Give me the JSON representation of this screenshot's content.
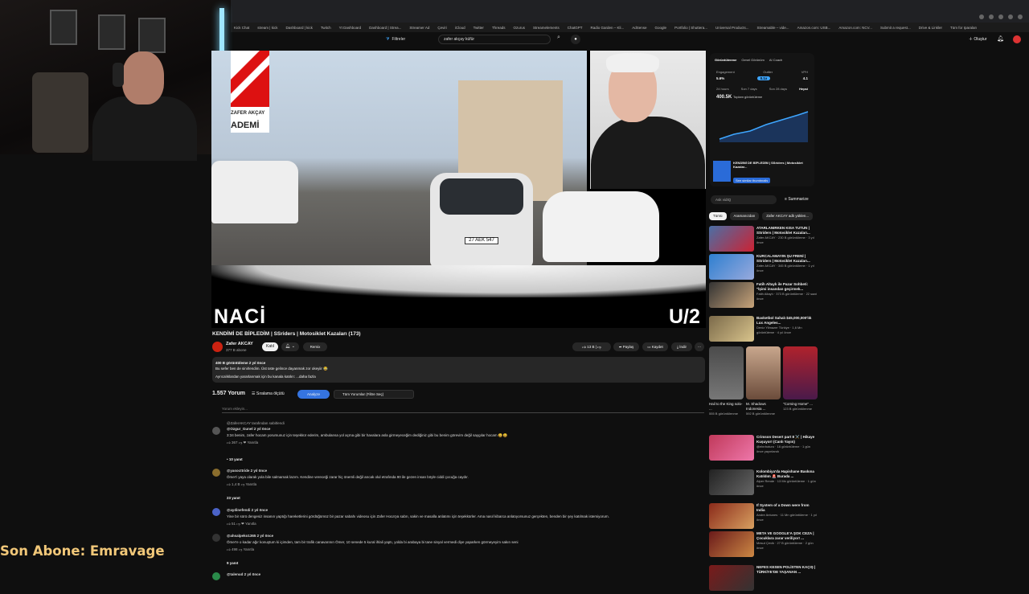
{
  "browser": {
    "bookmarks": [
      "Kick Chat",
      "stream | kick",
      "Dashboard | kick",
      "Twitch",
      "Yt Dashboard",
      "Dashboard | Strea...",
      "Streamer Ad",
      "Çeviri",
      "iCloud",
      "Twitter",
      "Threads",
      "Ozurus",
      "Streamelements",
      "ChatGPT",
      "Radio Garden – Kli...",
      "AdSense",
      "Google",
      "Portfolio | Shuttera...",
      "Universal Products...",
      "Streamable – vide...",
      "Amazon.com: USB...",
      "Amazon.com: NCV...",
      "Submit a request...",
      "Drive & Linkler",
      "Tüm for Iparaları"
    ]
  },
  "header": {
    "filters_label": "Filtreler",
    "search_value": "zafer akçay küfür",
    "create_label": "Oluştur"
  },
  "video": {
    "overlay_left": "NACİ",
    "overlay_right": "U/2",
    "brand_line1": "ZAFER AKÇAY",
    "brand_line2": "ADEMİ",
    "plate": "27 AEK 547",
    "title": "KENDİMİ DE BİPLEDİM | SSriders | Motosiklet Kazaları (173)",
    "channel": "Zafer AKCAY",
    "subs": "377 B abone",
    "join": "Katıl",
    "remix": "Remix",
    "likes": "13 B",
    "share": "Paylaş",
    "save": "Kaydet",
    "download": "İndir",
    "desc_line1": "400 B görüntüleme  2 yıl önce",
    "desc_line2": "Bu sefer ben de sinirlendim. Üst üste gelince dayanmak zor okeyiir 😂",
    "desc_line3": "Ayrıcalıklardan yararlanmak için bu kanala katılın: ...daha fazla"
  },
  "comments": {
    "count": "1.557 Yorum",
    "sort": "Sıralama ölçütü",
    "analyze": "Analyze",
    "filter": "Tüm Yorumlar (Filtre Seç)",
    "placeholder": "Yorum ekleyin...",
    "pinned": "@ZaferAKCAY tarafından sabitlendi",
    "items": [
      {
        "user": "@Ozgur_Gunel  2 yıl önce",
        "text": "3:34  benim, zafer hocam yorumunuz için teşekkür ederim, ambulansa yol açma gibi bir havalara asla girmeyeceğim dediğiniz gibi bu benim görevim değil saygılar hocam 😄😄",
        "likes": "367",
        "reply": "Yanıtla",
        "replies": "• 10 yanıt"
      },
      {
        "user": "@yasocttride  2 yıl önce",
        "text": "Ömer'i yaya olarak yola bile salmamak lazım. Kendine vereceği zarar hiç önemli değil ancak olul etrafında 90 ile gezen insan böyle ciddi çocuğa caydır.",
        "likes": "1,4 B",
        "reply": "Yanıtla",
        "replies": "23 yanıt"
      },
      {
        "user": "@aydinefendi  2 yıl önce",
        "text": "Yine bir sürü dengesiz insanın yaptığı hareketlerini gördüğümüz bir pazar sabahı videosu için Zafer Hoca'ya sabrı, sakin ve masalla anlatımı için teşekkürler. Ama nasıl kibarca anlatıyorsunuz gerçekten, benden bir şey katılmak istemiyorum.",
        "likes": "51",
        "reply": "Yanıtla",
        "replies": ""
      },
      {
        "user": "@ahsalpeko1365  2 yıl önce",
        "text": "Ömer'e o kadar ağır konuştum ki içimden, tam bir trafik canavarının Ömer, 10 senede 5 kural ihlali yaptı, yolda bi arabaya bi tane sinyal vermedi diye yaparken görmeyeyim sakın seni",
        "likes": "498",
        "reply": "Yanıtla",
        "replies": "9 yanıt"
      },
      {
        "user": "@talenud  2 yıl önce",
        "text": "",
        "likes": "",
        "reply": "",
        "replies": ""
      }
    ]
  },
  "sidebar": {
    "tabs": [
      "Görüntülenme",
      "Genel Görünüm",
      "AI Coach"
    ],
    "metrics": [
      "Engagement",
      "Outlier",
      "VPH"
    ],
    "metric_values": [
      "5.6%",
      "0.1x",
      "4.1"
    ],
    "ranges": [
      "24 hours",
      "Son 7 days",
      "Son 28 days",
      "Hepsi"
    ],
    "views": "400.5K",
    "views_label": "Toplam görüntüleme",
    "mini_title": "KENDİMİ DE BİPLEDİM | SSriders | Motosiklet Kazalar...",
    "mini_link": "See similar thumbnails",
    "ask_placeholder": "Ask vidIQ",
    "summarize": "Summarize",
    "chips": [
      "Tümü",
      "Aramanızdan",
      "Zafer AKCAY adlı yüklen..."
    ],
    "recs": [
      {
        "title": "ATARLANIRKEN KISA TUTUN | SSriders | Motosiklet Kazaları...",
        "meta": "Zafer AKCAY · 230 B görüntüleme · 3 yıl önce"
      },
      {
        "title": "KURCALAMAYIN ŞU FRENİ | SSriders | Motosiklet Kazaları...",
        "meta": "Zafer AKCAY · 345 B görüntüleme · 1 yıl önce"
      },
      {
        "title": "Fatih Altaylı ile Pazar Sohbeti: \"İşimi insandan geçirmek...",
        "meta": "Fatih Altaylı · 373 B görüntüleme · 22 saat önce"
      },
      {
        "title": "Basketbol Sahalı $45,000,000'lık Lux Angeles...",
        "meta": "Deniz Yilmazer Türkiye · 1,6 Mn görüntüleme · 4 yıl önce"
      }
    ],
    "shorts": [
      {
        "title": "Hail to the King solo- ...",
        "meta": "555 B görüntülenme"
      },
      {
        "title": "M. Shadows Indonesia ...",
        "meta": "592 B görüntülenme"
      },
      {
        "title": "\"Coming Home\" ...",
        "meta": "123 B görüntülenme"
      }
    ],
    "recs2": [
      {
        "title": "Crimson Desert part 8 ⚔️ | Hikaye Kuşuyor! (Canlı Yayın)",
        "meta": "@elnrboturo · 16 görüntüleme · 1 gün önce yayınlandı"
      },
      {
        "title": "Kolombiya'da Hapishane Baskına Katıldım 🚨 Burada ...",
        "meta": "Alper Rende · 13 Mn görüntüleme · 1 gün önce"
      },
      {
        "title": "If System of a Down were from India",
        "meta": "Andre Antunes · 11 Mn görüntüleme · 1 yıl önce"
      },
      {
        "title": "META VE GOOGLE'A ŞOK CEZA | Çocuklara zarar veriliyor! ...",
        "meta": "Mesut Çevik · 27 B görüntüleme · 2 gün önce"
      },
      {
        "title": "NEFES KESEN POLİSTEN KAÇIŞ | TÜRKİYE'DE YAŞANAN ...",
        "meta": ""
      }
    ]
  },
  "stream_overlay": "Son Abone: Emravage",
  "colors": {
    "accent": "#3574e0",
    "brand_red": "#d11111",
    "overlay_gold": "#f2c879"
  }
}
